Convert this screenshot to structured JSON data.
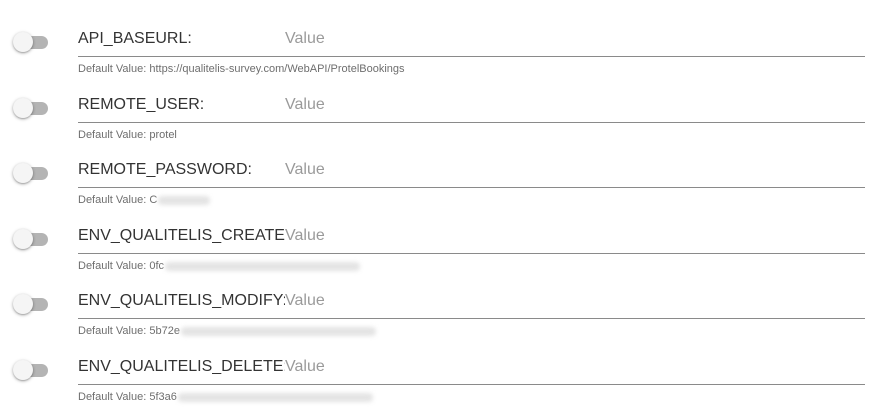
{
  "default_prefix": "Default Value:",
  "input_placeholder": "Value",
  "settings": [
    {
      "label": "API_BASEURL:",
      "default_visible": "https://qualitelis-survey.com/WebAPI/ProtelBookings",
      "enabled": false
    },
    {
      "label": "REMOTE_USER:",
      "default_visible": "protel",
      "enabled": false
    },
    {
      "label": "REMOTE_PASSWORD:",
      "default_visible": "C",
      "enabled": false
    },
    {
      "label": "ENV_QUALITELIS_CREATE:",
      "default_visible": "0fc",
      "enabled": false
    },
    {
      "label": "ENV_QUALITELIS_MODIFY:",
      "default_visible": "5b72e",
      "enabled": false
    },
    {
      "label": "ENV_QUALITELIS_DELETE:",
      "default_visible": "5f3a6",
      "enabled": false
    }
  ]
}
